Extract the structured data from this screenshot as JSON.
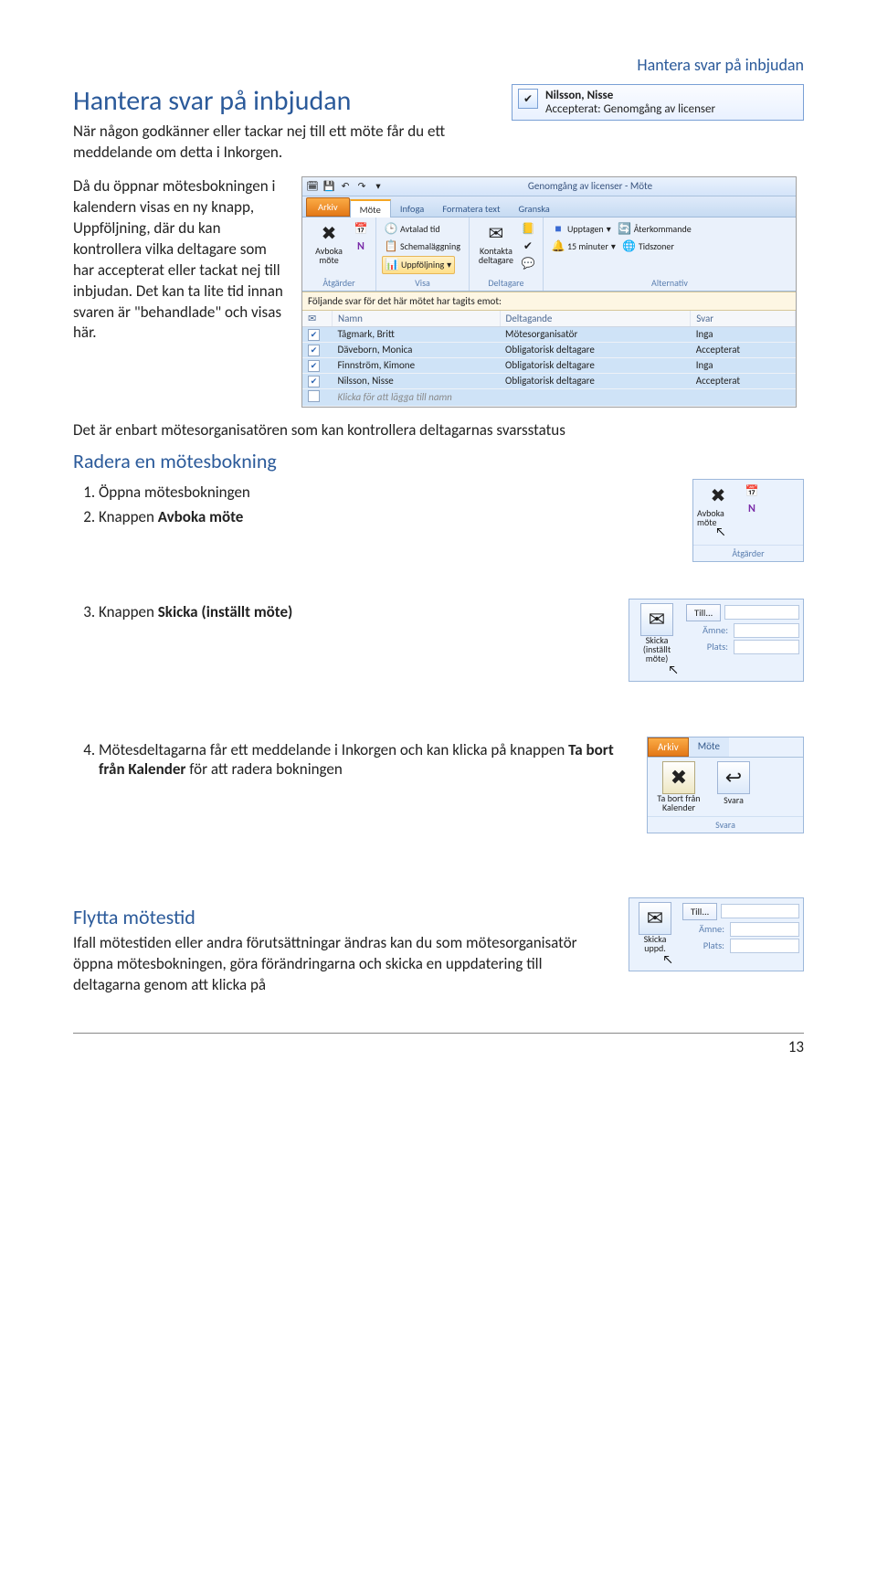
{
  "header": {
    "running": "Hantera svar på inbjudan"
  },
  "section1": {
    "title": "Hantera svar på inbjudan",
    "intro": "När någon godkänner eller tackar nej till ett möte får du ett meddelande om detta i Inkorgen.",
    "para": "Då du öppnar mötesbokningen i kalendern visas en ny knapp, Uppföljning, där du kan kontrollera vilka deltagare som har accepterat eller tackat nej till inbjudan. Det kan ta lite tid innan svaren är \"behandlade\" och visas här.",
    "note": "Det är enbart mötesorganisatören som kan kontrollera deltagarnas svarsstatus"
  },
  "acceptbox": {
    "name": "Nilsson, Nisse",
    "status": "Accepterat: Genomgång av licenser"
  },
  "ribbon": {
    "window_title": "Genomgång av licenser  -  Möte",
    "tabs": [
      "Arkiv",
      "Möte",
      "Infoga",
      "Formatera text",
      "Granska"
    ],
    "groups": {
      "atgarder": {
        "label": "Åtgärder",
        "avboka": "Avboka möte"
      },
      "visa": {
        "label": "Visa",
        "avtalad": "Avtalad tid",
        "schema": "Schemaläggning",
        "uppfolj": "Uppföljning"
      },
      "deltagare": {
        "label": "Deltagare",
        "kontakta": "Kontakta deltagare"
      },
      "alternativ": {
        "label": "Alternativ",
        "upptagen": "Upptagen",
        "aterkommande": "Återkommande",
        "minuter": "15 minuter",
        "tidszoner": "Tidszoner"
      }
    },
    "responses_line": "Följande svar för det här mötet har tagits emot:",
    "table": {
      "cols": [
        "",
        "Namn",
        "Deltagande",
        "Svar"
      ],
      "rows": [
        {
          "chk": true,
          "name": "Tågmark, Britt",
          "role": "Mötesorganisatör",
          "resp": "Inga"
        },
        {
          "chk": true,
          "name": "Däveborn, Monica",
          "role": "Obligatorisk deltagare",
          "resp": "Accepterat"
        },
        {
          "chk": true,
          "name": "Finnström, Kimone",
          "role": "Obligatorisk deltagare",
          "resp": "Inga"
        },
        {
          "chk": true,
          "name": "Nilsson, Nisse",
          "role": "Obligatorisk deltagare",
          "resp": "Accepterat"
        }
      ],
      "addrow": "Klicka för att lägga till namn"
    }
  },
  "section2": {
    "title": "Radera en mötesbokning",
    "items": [
      "Öppna mötesbokningen",
      "Knappen Avboka möte",
      "Knappen Skicka (inställt möte)",
      "Mötesdeltagarna får ett meddelande i Inkorgen och kan klicka på knappen Ta bort från Kalender för att radera bokningen"
    ]
  },
  "fig_avboka": {
    "btn": "Avboka möte",
    "group": "Åtgärder"
  },
  "fig_skicka": {
    "btn": "Skicka (inställt möte)",
    "till": "Till...",
    "amne": "Ämne:",
    "plats": "Plats:"
  },
  "fig_tabort": {
    "tab_arkiv": "Arkiv",
    "tab_mote": "Möte",
    "btn_tabort": "Ta bort från Kalender",
    "btn_svara": "Svara",
    "group": "Svara"
  },
  "section3": {
    "title": "Flytta mötestid",
    "para": "Ifall mötestiden eller andra förutsättningar ändras kan du som mötesorganisatör öppna mötesbokningen, göra förändringarna och skicka en uppdatering till deltagarna genom att klicka på"
  },
  "fig_uppd": {
    "btn": "Skicka uppd.",
    "till": "Till...",
    "amne": "Ämne:",
    "plats": "Plats:"
  },
  "pagenum": "13"
}
